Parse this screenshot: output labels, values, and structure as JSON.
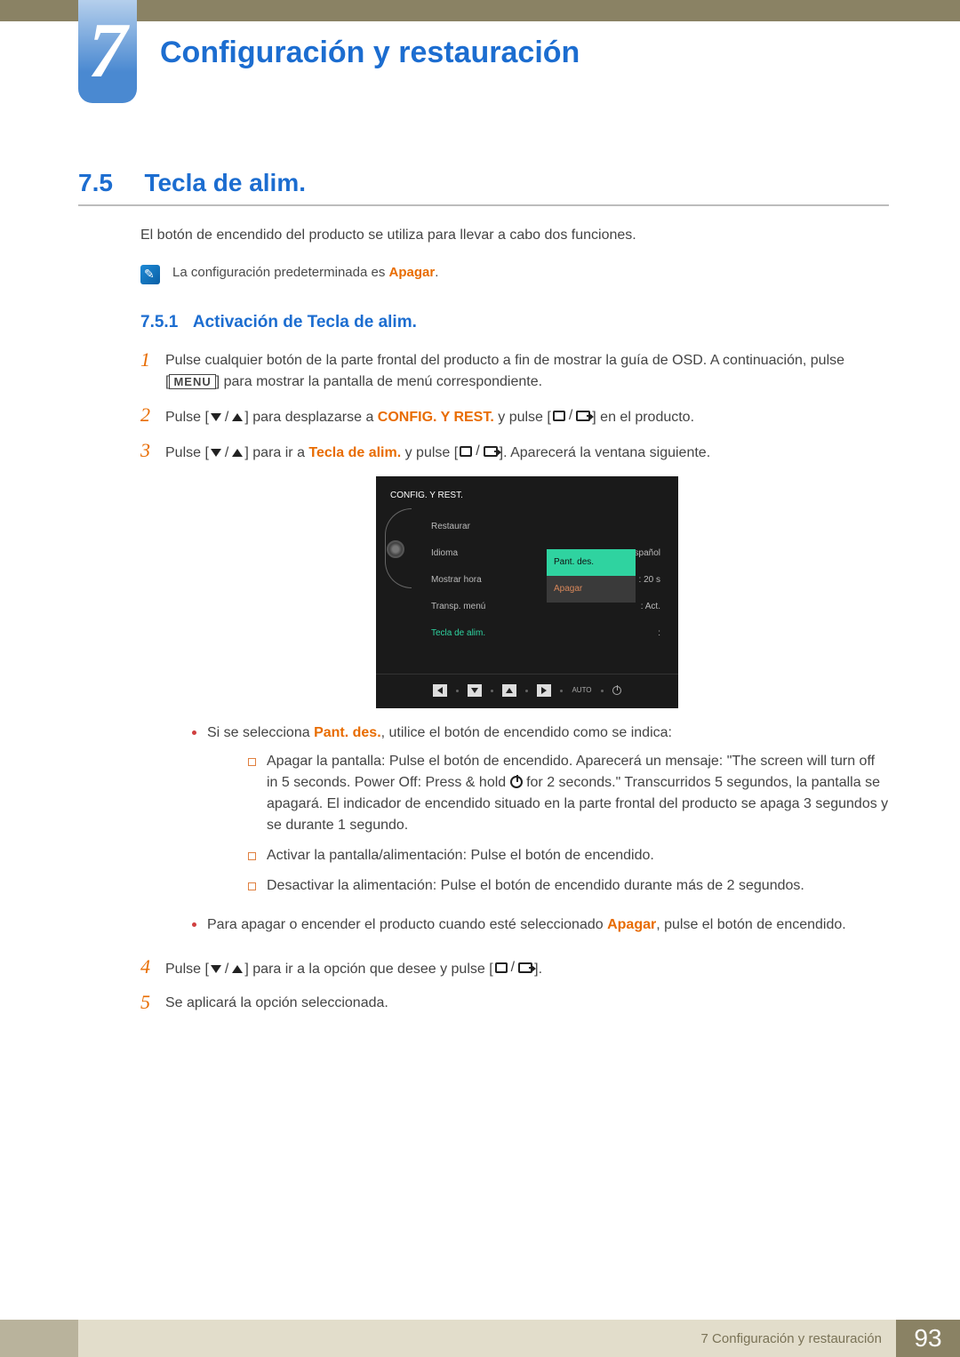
{
  "chapter": {
    "number": "7",
    "title": "Configuración y restauración"
  },
  "section": {
    "number": "7.5",
    "title": "Tecla de alim."
  },
  "intro": "El botón de encendido del producto se utiliza para llevar a cabo dos funciones.",
  "note": {
    "pre": "La configuración predeterminada es ",
    "hl": "Apagar",
    "post": "."
  },
  "subsection": {
    "number": "7.5.1",
    "title": "Activación de Tecla de alim."
  },
  "steps": {
    "s1a": "Pulse cualquier botón de la parte frontal del producto a fin de mostrar la guía de OSD. A continuación, pulse [",
    "s1b": "] para mostrar la pantalla de menú correspondiente.",
    "menu_key": "MENU",
    "s2a": "Pulse [",
    "s2b": "] para desplazarse a ",
    "s2hl": "CONFIG. Y REST.",
    "s2c": " y pulse [",
    "s2d": "] en el producto.",
    "s3a": "Pulse [",
    "s3b": "] para ir a ",
    "s3hl": "Tecla de alim.",
    "s3c": " y pulse [",
    "s3d": "]. Aparecerá la ventana siguiente.",
    "s4a": "Pulse [",
    "s4b": "] para ir a la opción que desee y pulse [",
    "s4c": "].",
    "s5": "Se aplicará la opción seleccionada."
  },
  "osd": {
    "title": "CONFIG. Y REST.",
    "r1": "Restaurar",
    "r2": "Idioma",
    "r2v": "Español",
    "r3": "Mostrar hora",
    "r3v": "20 s",
    "r4": "Transp. menú",
    "r4v": "Act.",
    "r5": "Tecla de alim.",
    "popup_sel": "Pant. des.",
    "popup_unsel": "Apagar",
    "auto": "AUTO"
  },
  "bullets": {
    "b1a": "Si se selecciona ",
    "b1hl": "Pant. des.",
    "b1b": ", utilice el botón de encendido como se indica:",
    "sub1a": "Apagar la pantalla: Pulse el botón de encendido. Aparecerá un mensaje: \"The screen will turn off in 5 seconds. Power Off: Press & hold ",
    "sub1b": " for 2 seconds.\" Transcurridos 5 segundos, la pantalla se apagará. El indicador de encendido situado en la parte frontal del producto se apaga 3 segundos y se durante 1 segundo.",
    "sub2": "Activar la pantalla/alimentación: Pulse el botón de encendido.",
    "sub3": "Desactivar la alimentación: Pulse el botón de encendido durante más de 2 segundos.",
    "b2a": "Para apagar o encender el producto cuando esté seleccionado ",
    "b2hl": "Apagar",
    "b2b": ", pulse el botón de encendido."
  },
  "footer": {
    "label": "7 Configuración y restauración",
    "page": "93"
  }
}
